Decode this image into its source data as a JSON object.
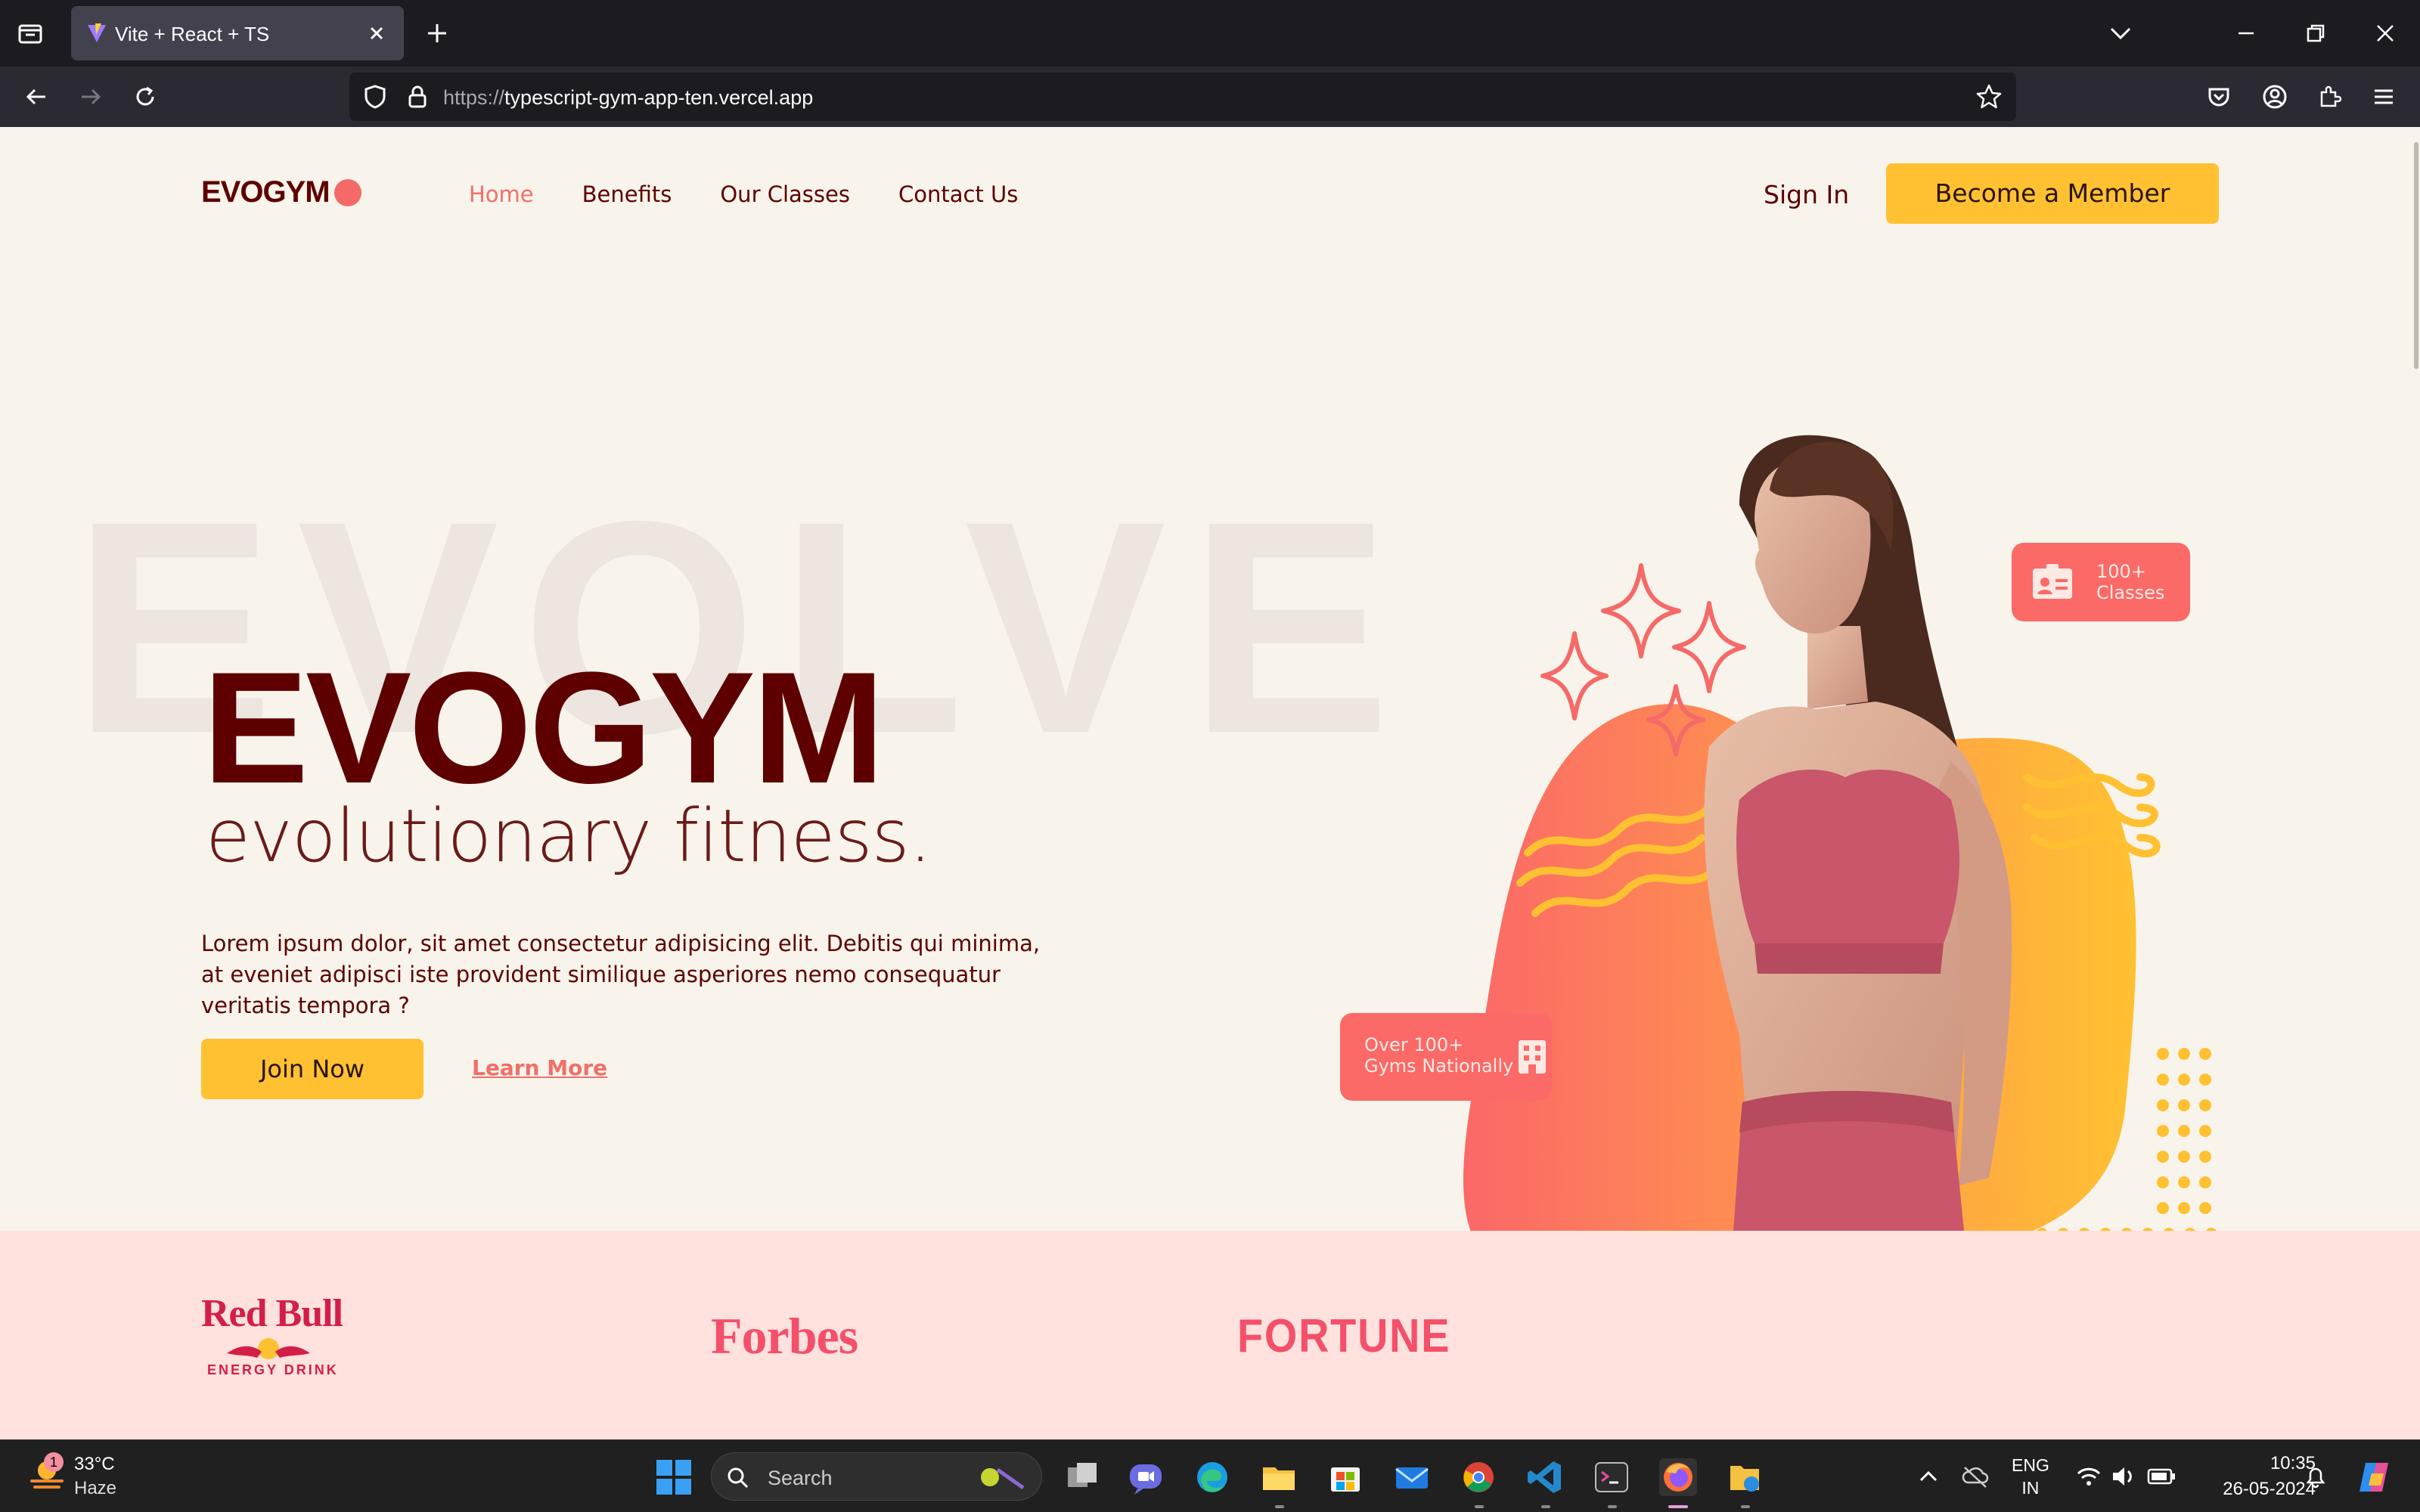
{
  "browser": {
    "tab_title": "Vite + React + TS",
    "url_scheme": "https://",
    "url_host": "typescript-gym-app-ten.vercel.app"
  },
  "site": {
    "brand": "EVOGYM",
    "nav": {
      "home": "Home",
      "benefits": "Benefits",
      "classes": "Our Classes",
      "contact": "Contact Us"
    },
    "sign_in": "Sign In",
    "member_button": "Become a Member",
    "hero": {
      "background_word": "EVOLVE",
      "title": "EVOGYM",
      "subtitle": "evolutionary fitness.",
      "text": "Lorem ipsum dolor, sit amet consectetur adipisicing elit. Debitis qui minima, at eveniet adipisci iste provident similique asperiores nemo consequatur veritatis tempora ?",
      "join_button": "Join Now",
      "learn_more": "Learn More",
      "badge_classes_line1": "100+",
      "badge_classes_line2": "Classes",
      "badge_gyms_line1": "Over 100+",
      "badge_gyms_line2": "Gyms Nationally"
    },
    "sponsors": {
      "redbull": "Red Bull",
      "redbull_sub": "ENERGY DRINK",
      "forbes": "Forbes",
      "fortune": "FORTUNE"
    },
    "colors": {
      "primary_dark": "#5e0000",
      "accent_coral": "#f26f6a",
      "accent_yellow": "#ffc132",
      "page_bg": "#f8f4eb",
      "sponsor_bg": "#ffe1dd"
    }
  },
  "taskbar": {
    "weather_temp": "33°C",
    "weather_cond": "Haze",
    "weather_badge": "1",
    "search_label": "Search",
    "lang_line1": "ENG",
    "lang_line2": "IN",
    "time": "10:35",
    "date": "26-05-2024"
  }
}
